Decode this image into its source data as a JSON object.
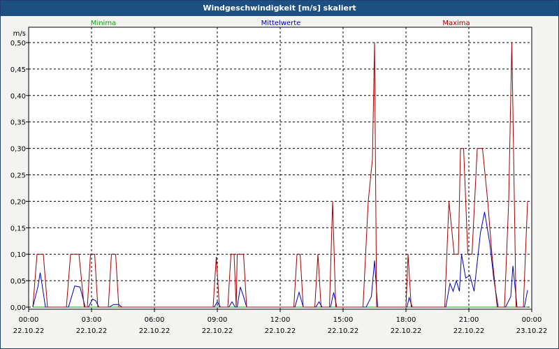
{
  "window": {
    "title": "Windgeschwindigkeit [m/s] skaliert"
  },
  "colors": {
    "min": "#00aa00",
    "mean": "#0000b4",
    "max": "#a00000",
    "titlebar": "#1e4f82"
  },
  "chart_data": {
    "type": "line",
    "title": "Windgeschwindigkeit [m/s] skaliert",
    "ylabel": "m/s",
    "ylim": [
      0,
      0.5
    ],
    "xlim": [
      0,
      24
    ],
    "grid": true,
    "legend_position": "top",
    "y_ticks": [
      "0,00",
      "0,05",
      "0,10",
      "0,15",
      "0,20",
      "0,25",
      "0,30",
      "0,35",
      "0,40",
      "0,45",
      "0,50"
    ],
    "x_ticks": [
      {
        "time": "00:00",
        "date": "22.10.22"
      },
      {
        "time": "03:00",
        "date": "22.10.22"
      },
      {
        "time": "06:00",
        "date": "22.10.22"
      },
      {
        "time": "09:00",
        "date": "22.10.22"
      },
      {
        "time": "12:00",
        "date": "22.10.22"
      },
      {
        "time": "15:00",
        "date": "22.10.22"
      },
      {
        "time": "18:00",
        "date": "22.10.22"
      },
      {
        "time": "21:00",
        "date": "22.10.22"
      },
      {
        "time": "00:00",
        "date": "23.10.22"
      }
    ],
    "series": [
      {
        "name": "Minima",
        "key": "min",
        "points": [
          [
            0.2,
            0
          ],
          [
            23.8,
            0
          ]
        ]
      },
      {
        "name": "Mittelwerte",
        "key": "mean",
        "points": [
          [
            0.2,
            0
          ],
          [
            0.45,
            0.04
          ],
          [
            0.55,
            0.065
          ],
          [
            0.65,
            0.04
          ],
          [
            0.8,
            0
          ],
          [
            1.9,
            0
          ],
          [
            2.2,
            0.04
          ],
          [
            2.45,
            0.038
          ],
          [
            2.7,
            0
          ],
          [
            2.85,
            0
          ],
          [
            3.05,
            0.015
          ],
          [
            3.2,
            0.012
          ],
          [
            3.35,
            0
          ],
          [
            3.85,
            0
          ],
          [
            4.05,
            0.005
          ],
          [
            4.3,
            0.005
          ],
          [
            4.45,
            0
          ],
          [
            8.85,
            0
          ],
          [
            9.0,
            0.01
          ],
          [
            9.15,
            0
          ],
          [
            9.55,
            0
          ],
          [
            9.7,
            0.01
          ],
          [
            9.85,
            0
          ],
          [
            9.95,
            0
          ],
          [
            10.1,
            0.038
          ],
          [
            10.25,
            0.02
          ],
          [
            10.4,
            0
          ],
          [
            12.7,
            0
          ],
          [
            12.9,
            0.028
          ],
          [
            13.1,
            0
          ],
          [
            13.7,
            0
          ],
          [
            13.85,
            0.01
          ],
          [
            14.0,
            0
          ],
          [
            14.4,
            0
          ],
          [
            14.55,
            0.028
          ],
          [
            14.7,
            0
          ],
          [
            16.1,
            0
          ],
          [
            16.35,
            0.02
          ],
          [
            16.5,
            0.088
          ],
          [
            16.65,
            0
          ],
          [
            18.05,
            0
          ],
          [
            18.15,
            0.018
          ],
          [
            18.3,
            0
          ],
          [
            19.9,
            0
          ],
          [
            20.1,
            0.045
          ],
          [
            20.25,
            0.03
          ],
          [
            20.4,
            0.05
          ],
          [
            20.55,
            0.03
          ],
          [
            20.65,
            0.1
          ],
          [
            20.85,
            0.055
          ],
          [
            21.05,
            0.06
          ],
          [
            21.25,
            0.03
          ],
          [
            21.55,
            0.14
          ],
          [
            21.75,
            0.18
          ],
          [
            22.0,
            0.12
          ],
          [
            22.2,
            0.05
          ],
          [
            22.4,
            0
          ],
          [
            22.75,
            0
          ],
          [
            23.0,
            0.02
          ],
          [
            23.1,
            0.078
          ],
          [
            23.3,
            0
          ],
          [
            23.65,
            0
          ],
          [
            23.8,
            0.032
          ]
        ]
      },
      {
        "name": "Maxima",
        "key": "max",
        "points": [
          [
            0.2,
            0
          ],
          [
            0.4,
            0.1
          ],
          [
            0.7,
            0.1
          ],
          [
            0.9,
            0
          ],
          [
            1.8,
            0
          ],
          [
            2.0,
            0.1
          ],
          [
            2.4,
            0.1
          ],
          [
            2.65,
            0
          ],
          [
            2.8,
            0
          ],
          [
            2.95,
            0.1
          ],
          [
            3.15,
            0.1
          ],
          [
            3.3,
            0
          ],
          [
            3.8,
            0
          ],
          [
            3.95,
            0.1
          ],
          [
            4.15,
            0.1
          ],
          [
            4.3,
            0
          ],
          [
            8.8,
            0
          ],
          [
            8.95,
            0.095
          ],
          [
            9.1,
            0
          ],
          [
            9.5,
            0
          ],
          [
            9.65,
            0.1
          ],
          [
            9.8,
            0.1
          ],
          [
            9.9,
            0
          ],
          [
            9.95,
            0.1
          ],
          [
            10.25,
            0.1
          ],
          [
            10.4,
            0
          ],
          [
            12.65,
            0
          ],
          [
            12.8,
            0.1
          ],
          [
            12.95,
            0.1
          ],
          [
            13.1,
            0
          ],
          [
            13.65,
            0
          ],
          [
            13.8,
            0.1
          ],
          [
            13.95,
            0
          ],
          [
            14.35,
            0
          ],
          [
            14.5,
            0.2
          ],
          [
            14.65,
            0
          ],
          [
            15.95,
            0
          ],
          [
            16.2,
            0.2
          ],
          [
            16.4,
            0.28
          ],
          [
            16.5,
            0.5
          ],
          [
            16.6,
            0
          ],
          [
            18.0,
            0
          ],
          [
            18.1,
            0.1
          ],
          [
            18.25,
            0
          ],
          [
            19.85,
            0
          ],
          [
            20.05,
            0.2
          ],
          [
            20.3,
            0.1
          ],
          [
            20.5,
            0.1
          ],
          [
            20.6,
            0.3
          ],
          [
            20.75,
            0.3
          ],
          [
            20.95,
            0.1
          ],
          [
            21.15,
            0.1
          ],
          [
            21.4,
            0.3
          ],
          [
            21.65,
            0.3
          ],
          [
            21.9,
            0.2
          ],
          [
            22.1,
            0.1
          ],
          [
            22.35,
            0
          ],
          [
            22.7,
            0
          ],
          [
            22.9,
            0.2
          ],
          [
            23.05,
            0.5
          ],
          [
            23.25,
            0
          ],
          [
            23.6,
            0
          ],
          [
            23.8,
            0.2
          ]
        ]
      }
    ]
  }
}
